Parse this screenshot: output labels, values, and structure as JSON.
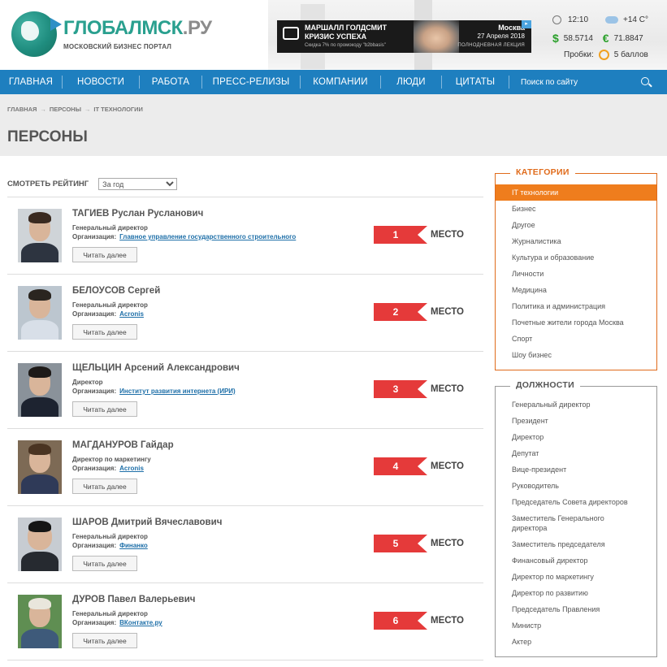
{
  "header": {
    "logo_title": "ГЛОБАЛМСК",
    "logo_ru": ".РУ",
    "logo_subtitle": "МОСКОВСКИЙ БИЗНЕС ПОРТАЛ",
    "banner": {
      "line1": "МАРШАЛЛ ГОЛДСМИТ",
      "line2": "КРИЗИС УСПЕХА",
      "promo": "Скидка 7% по промокоду \"b2bbasis\"",
      "city": "Москва",
      "date": "27 Апреля 2018",
      "lecture": "ПОЛНОДНЕВНАЯ ЛЕКЦИЯ"
    },
    "info": {
      "time": "12:10",
      "temperature": "+14 C°",
      "usd": "58.5714",
      "eur": "71.8847",
      "traffic_label": "Пробки:",
      "traffic_value": "5 баллов"
    }
  },
  "nav": {
    "items": [
      "ГЛАВНАЯ",
      "НОВОСТИ",
      "РАБОТА",
      "ПРЕСС-РЕЛИЗЫ",
      "КОМПАНИИ",
      "ЛЮДИ",
      "ЦИТАТЫ"
    ],
    "search_placeholder": "Поиск по сайту"
  },
  "breadcrumb": [
    "ГЛАВНАЯ",
    "ПЕРСОНЫ",
    "IT ТЕХНОЛОГИИ"
  ],
  "page_title": "ПЕРСОНЫ",
  "rating": {
    "label": "СМОТРЕТЬ РЕЙТИНГ",
    "selected": "За год"
  },
  "persons": [
    {
      "name": "ТАГИЕВ Руслан Русланович",
      "role": "Генеральный директор",
      "org_label": "Организация:",
      "org": "Главное управление государственного строительного",
      "button": "Читать далее",
      "place": "1",
      "place_label": "МЕСТО"
    },
    {
      "name": "БЕЛОУСОВ Сергей",
      "role": "Генеральный директор",
      "org_label": "Организация:",
      "org": "Acronis",
      "button": "Читать далее",
      "place": "2",
      "place_label": "МЕСТО"
    },
    {
      "name": "ЩЕЛЬЦИН Арсений Александрович",
      "role": "Директор",
      "org_label": "Организация:",
      "org": "Институт развития интернета (ИРИ)",
      "button": "Читать далее",
      "place": "3",
      "place_label": "МЕСТО"
    },
    {
      "name": "МАГДАНУРОВ Гайдар",
      "role": "Директор по маркетингу",
      "org_label": "Организация:",
      "org": "Acronis",
      "button": "Читать далее",
      "place": "4",
      "place_label": "МЕСТО"
    },
    {
      "name": "ШАРОВ Дмитрий Вячеславович",
      "role": "Генеральный директор",
      "org_label": "Организация:",
      "org": "Финанко",
      "button": "Читать далее",
      "place": "5",
      "place_label": "МЕСТО"
    },
    {
      "name": "ДУРОВ Павел Валерьевич",
      "role": "Генеральный директор",
      "org_label": "Организация:",
      "org": "ВКонтакте.ру",
      "button": "Читать далее",
      "place": "6",
      "place_label": "МЕСТО"
    }
  ],
  "categories": {
    "title": "КАТЕГОРИИ",
    "items": [
      "IT технологии",
      "Бизнес",
      "Другое",
      "Журналистика",
      "Культура и образование",
      "Личности",
      "Медицина",
      "Политика и администрация",
      "Почетные жители города Москва",
      "Спорт",
      "Шоу бизнес"
    ]
  },
  "positions": {
    "title": "ДОЛЖНОСТИ",
    "items": [
      "Генеральный директор",
      "Президент",
      "Директор",
      "Депутат",
      "Вице-президент",
      "Руководитель",
      "Председатель Совета директоров",
      "Заместитель Генерального директора",
      "Заместитель председателя",
      "Финансовый директор",
      "Директор по маркетингу",
      "Директор по развитию",
      "Председатель Правления",
      "Министр",
      "Актер"
    ]
  }
}
